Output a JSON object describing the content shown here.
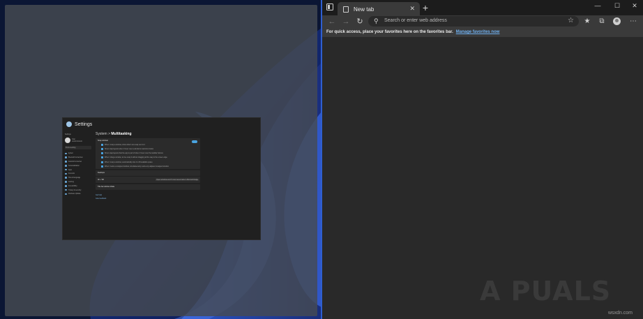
{
  "desktop": {
    "settings_thumbnail": {
      "title": "Settings",
      "sidebar": {
        "label": "Settings",
        "user_name": "User",
        "user_email": "Local Account",
        "search_placeholder": "Find a setting",
        "items": [
          "System",
          "Bluetooth & devices",
          "Network & internet",
          "Personalization",
          "Apps",
          "Accounts",
          "Time & language",
          "Gaming",
          "Accessibility",
          "Privacy & security",
          "Windows Update"
        ]
      },
      "breadcrumb": {
        "parent": "System",
        "separator": ">",
        "current": "Multitasking"
      },
      "snap_windows": {
        "title": "Snap windows",
        "options": [
          "When I snap a window, show what I can snap next to it",
          "Show snap layouts when I hover over a window's maximize button",
          "Show snap layouts that the app is part of when I hover over the taskbar buttons",
          "When I drag a window, let me snap it without dragging all the way to the screen edge",
          "When I snap a window, automatically size it to fill available space",
          "When I resize a snapped window, simultaneously resize any adjacent snapped window"
        ]
      },
      "desktops": {
        "title": "Desktops"
      },
      "alt_tab": {
        "title": "Alt + Tab",
        "value": "Open windows and 5 most recent tabs in Microsoft Edge"
      },
      "title_bar": {
        "title": "Title bar window shake"
      },
      "links": [
        "Get help",
        "Give feedback"
      ]
    }
  },
  "browser": {
    "tab": {
      "label": "New tab",
      "close": "✕"
    },
    "new_tab": "+",
    "window_controls": {
      "minimize": "—",
      "maximize": "☐",
      "close": "✕"
    },
    "nav": {
      "back": "←",
      "forward": "→",
      "refresh": "↻"
    },
    "address": {
      "placeholder": "Search or enter web address"
    },
    "favorites_bar": {
      "message": "For quick access, place your favorites here on the favorites bar.",
      "manage_link": "Manage favorites now"
    },
    "more": "⋯"
  },
  "watermark": {
    "logo": "A PUALS",
    "site": "wsxdn.com"
  },
  "colors": {
    "accent": "#4aa3df",
    "divider": "#2e5fd1",
    "wallpaper": "#0d1a3a"
  }
}
